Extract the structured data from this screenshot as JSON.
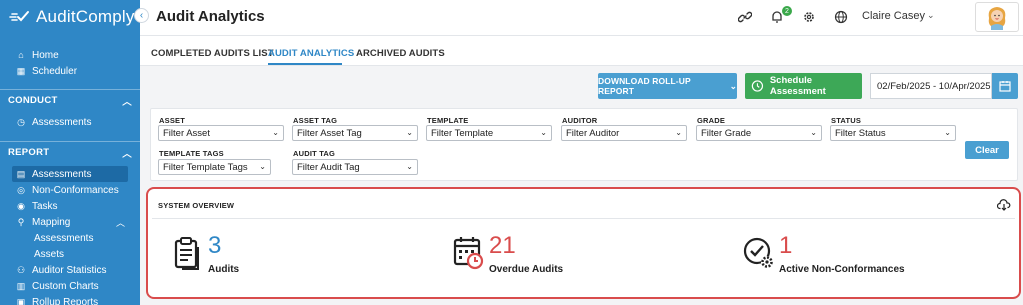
{
  "app": {
    "brand": "AuditComply"
  },
  "sidebar": {
    "top_items": [
      {
        "label": "Home",
        "icon": "home-icon"
      },
      {
        "label": "Scheduler",
        "icon": "calendar-icon"
      }
    ],
    "conduct": {
      "title": "CONDUCT",
      "items": [
        {
          "label": "Assessments",
          "icon": "clock-icon"
        }
      ]
    },
    "report": {
      "title": "REPORT",
      "items": [
        {
          "label": "Assessments",
          "icon": "list-icon"
        },
        {
          "label": "Non-Conformances",
          "icon": "target-icon"
        },
        {
          "label": "Tasks",
          "icon": "check-circle-icon"
        },
        {
          "label": "Mapping",
          "icon": "map-pin-icon"
        },
        {
          "label": "Assessments"
        },
        {
          "label": "Assets"
        },
        {
          "label": "Auditor Statistics",
          "icon": "users-icon"
        },
        {
          "label": "Custom Charts",
          "icon": "chart-icon"
        },
        {
          "label": "Rollup Reports",
          "icon": "report-icon"
        }
      ]
    }
  },
  "header": {
    "title": "Audit Analytics",
    "notification_count": "2",
    "user_name": "Claire Casey"
  },
  "tabs": [
    {
      "label": "COMPLETED AUDITS LIST"
    },
    {
      "label": "AUDIT ANALYTICS"
    },
    {
      "label": "ARCHIVED AUDITS"
    }
  ],
  "actions": {
    "rollup_label": "DOWNLOAD ROLL-UP REPORT",
    "schedule_label": "Schedule Assessment",
    "date_range": "02/Feb/2025 - 10/Apr/2025"
  },
  "filters": [
    {
      "label": "ASSET",
      "value": "Filter Asset"
    },
    {
      "label": "ASSET TAG",
      "value": "Filter Asset Tag"
    },
    {
      "label": "TEMPLATE",
      "value": "Filter Template"
    },
    {
      "label": "AUDITOR",
      "value": "Filter Auditor"
    },
    {
      "label": "GRADE",
      "value": "Filter Grade"
    },
    {
      "label": "STATUS",
      "value": "Filter Status"
    },
    {
      "label": "TEMPLATE TAGS",
      "value": "Filter Template Tags"
    },
    {
      "label": "AUDIT TAG",
      "value": "Filter Audit Tag"
    }
  ],
  "clear_label": "Clear",
  "overview": {
    "title": "SYSTEM OVERVIEW",
    "stats": [
      {
        "value": "3",
        "label": "Audits",
        "color": "#2f87c6"
      },
      {
        "value": "21",
        "label": "Overdue Audits",
        "color": "#d94c4c"
      },
      {
        "value": "1",
        "label": "Active Non-Conformances",
        "color": "#d94c4c"
      }
    ]
  },
  "colors": {
    "primary": "#2f87c6",
    "success": "#3da857",
    "danger": "#d94c4c"
  }
}
